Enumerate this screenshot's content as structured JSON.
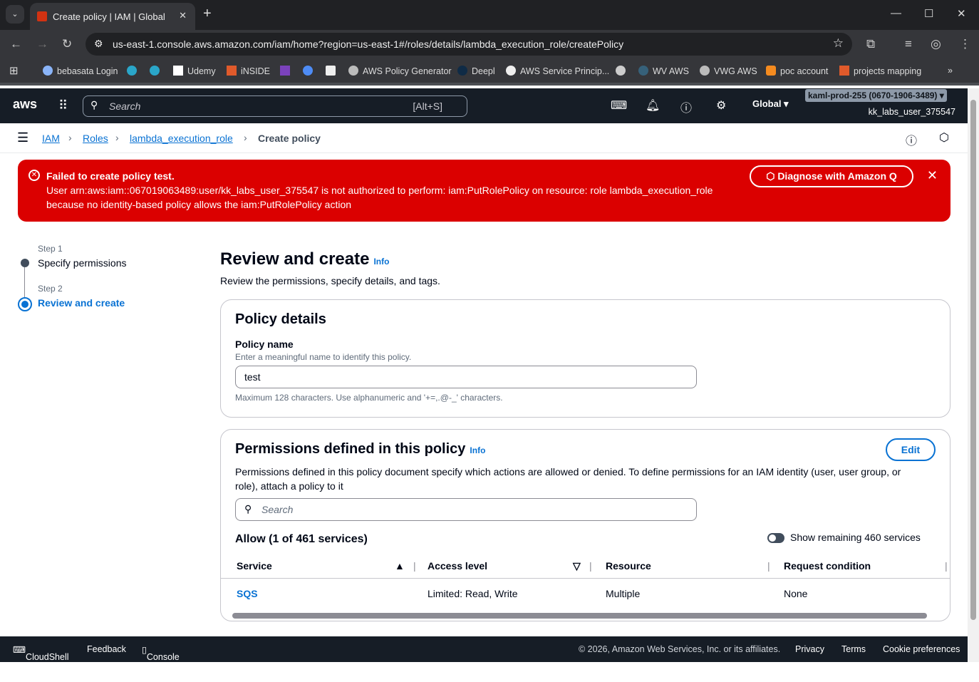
{
  "browser": {
    "tab_title": "Create policy | IAM | Global",
    "url": "us-east-1.console.aws.amazon.com/iam/home?region=us-east-1#/roles/details/lambda_execution_role/createPolicy",
    "bookmarks": [
      "bebasata Login",
      "Udemy",
      "iNSIDE",
      "AWS Policy Generator",
      "Deepl",
      "AWS Service Princip...",
      "WV AWS",
      "VWG AWS",
      "poc account",
      "projects mapping"
    ]
  },
  "aws_nav": {
    "search_placeholder": "Search",
    "search_shortcut": "[Alt+S]",
    "region": "Global ▾",
    "account": "kaml-prod-255 (0670-1906-3489) ▾",
    "user": "kk_labs_user_375547"
  },
  "breadcrumb": [
    "IAM",
    "Roles",
    "lambda_execution_role",
    "Create policy"
  ],
  "flash": {
    "title": "Failed to create policy test.",
    "message": "User arn:aws:iam::067019063489:user/kk_labs_user_375547 is not authorized to perform: iam:PutRolePolicy on resource: role lambda_execution_role because no identity-based policy allows the iam:PutRolePolicy action",
    "button": "Diagnose with Amazon Q"
  },
  "steps": [
    {
      "num": "Step 1",
      "label": "Specify permissions"
    },
    {
      "num": "Step 2",
      "label": "Review and create"
    }
  ],
  "page": {
    "title": "Review and create",
    "info": "Info",
    "subtitle": "Review the permissions, specify details, and tags."
  },
  "details": {
    "title": "Policy details",
    "name_label": "Policy name",
    "name_desc": "Enter a meaningful name to identify this policy.",
    "name_value": "test",
    "name_hint": "Maximum 128 characters. Use alphanumeric and '+=,.@-_' characters."
  },
  "permissions": {
    "title": "Permissions defined in this policy",
    "info": "Info",
    "edit": "Edit",
    "desc": "Permissions defined in this policy document specify which actions are allowed or denied. To define permissions for an IAM identity (user, user group, or role), attach a policy to it",
    "search_placeholder": "Search",
    "allow": "Allow (1 of 461 services)",
    "toggle": "Show remaining 460 services",
    "columns": [
      "Service",
      "Access level",
      "Resource",
      "Request condition"
    ],
    "rows": [
      [
        "SQS",
        "Limited: Read, Write",
        "Multiple",
        "None"
      ]
    ]
  },
  "footer": {
    "cloudshell": "CloudShell",
    "feedback": "Feedback",
    "mobile": "Console Mobile App",
    "copyright": "© 2026, Amazon Web Services, Inc. or its affiliates.",
    "privacy": "Privacy",
    "terms": "Terms",
    "cookies": "Cookie preferences"
  }
}
